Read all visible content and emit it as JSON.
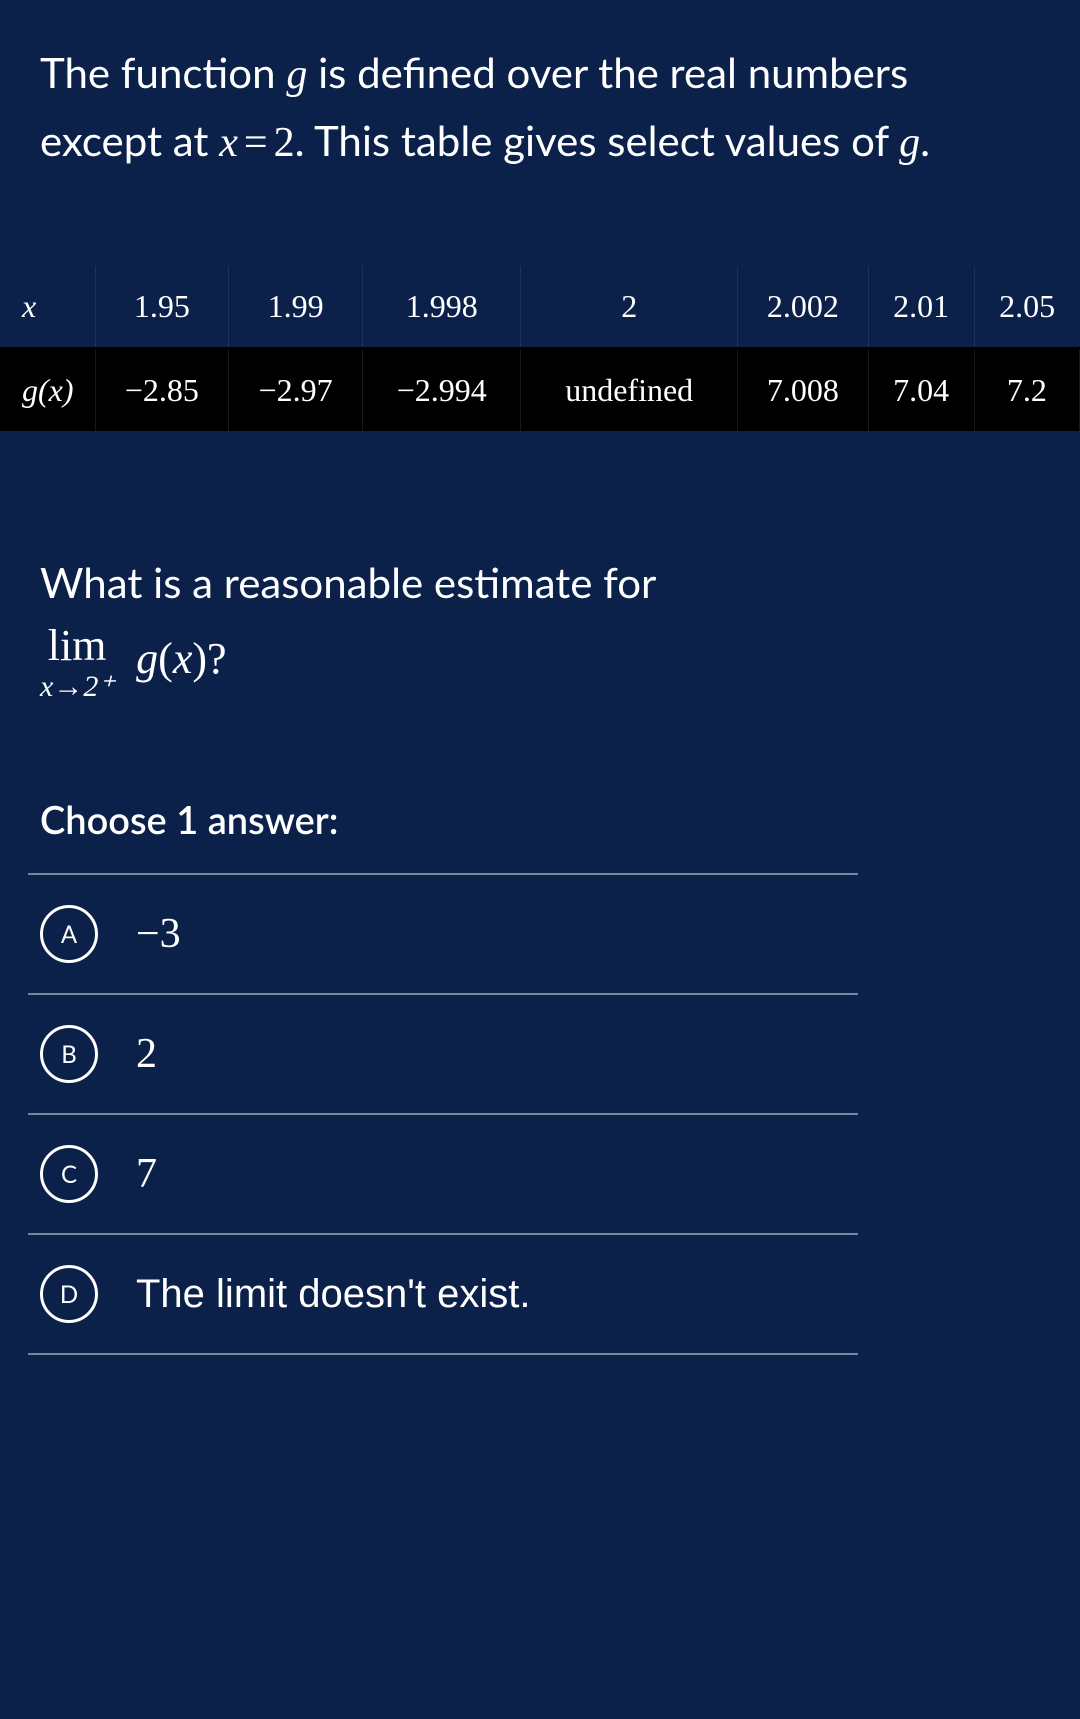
{
  "problem": {
    "text_part1": "The function ",
    "func_var": "g",
    "text_part2": " is defined over the real numbers except at ",
    "eq_var": "x",
    "eq_op": "=",
    "eq_val": "2",
    "text_part3": ". This table gives select values of ",
    "func_var2": "g",
    "text_part4": "."
  },
  "table": {
    "row1_header": "x",
    "row2_header": "g(x)",
    "x_values": [
      "1.95",
      "1.99",
      "1.998",
      "2",
      "2.002",
      "2.01",
      "2.05"
    ],
    "g_values": [
      "−2.85",
      "−2.97",
      "−2.994",
      "undefined",
      "7.008",
      "7.04",
      "7.2"
    ]
  },
  "question": {
    "prompt_text": "What is a reasonable estimate for",
    "limit_top": "lim",
    "limit_sub": "x→2⁺",
    "limit_body_func": "g",
    "limit_body_open": "(",
    "limit_body_arg": "x",
    "limit_body_close": ")",
    "qmark": "?"
  },
  "choose_label": "Choose 1 answer:",
  "choices": [
    {
      "letter": "A",
      "text": "−3",
      "math": true
    },
    {
      "letter": "B",
      "text": "2",
      "math": true
    },
    {
      "letter": "C",
      "text": "7",
      "math": true
    },
    {
      "letter": "D",
      "text": "The limit doesn't exist.",
      "math": false
    }
  ],
  "chart_data": {
    "type": "table",
    "title": "Select values of g near x = 2",
    "columns": [
      "x",
      "g(x)"
    ],
    "rows": [
      [
        1.95,
        -2.85
      ],
      [
        1.99,
        -2.97
      ],
      [
        1.998,
        -2.994
      ],
      [
        2,
        null
      ],
      [
        2.002,
        7.008
      ],
      [
        2.01,
        7.04
      ],
      [
        2.05,
        7.2
      ]
    ],
    "note": "g is undefined at x = 2"
  }
}
